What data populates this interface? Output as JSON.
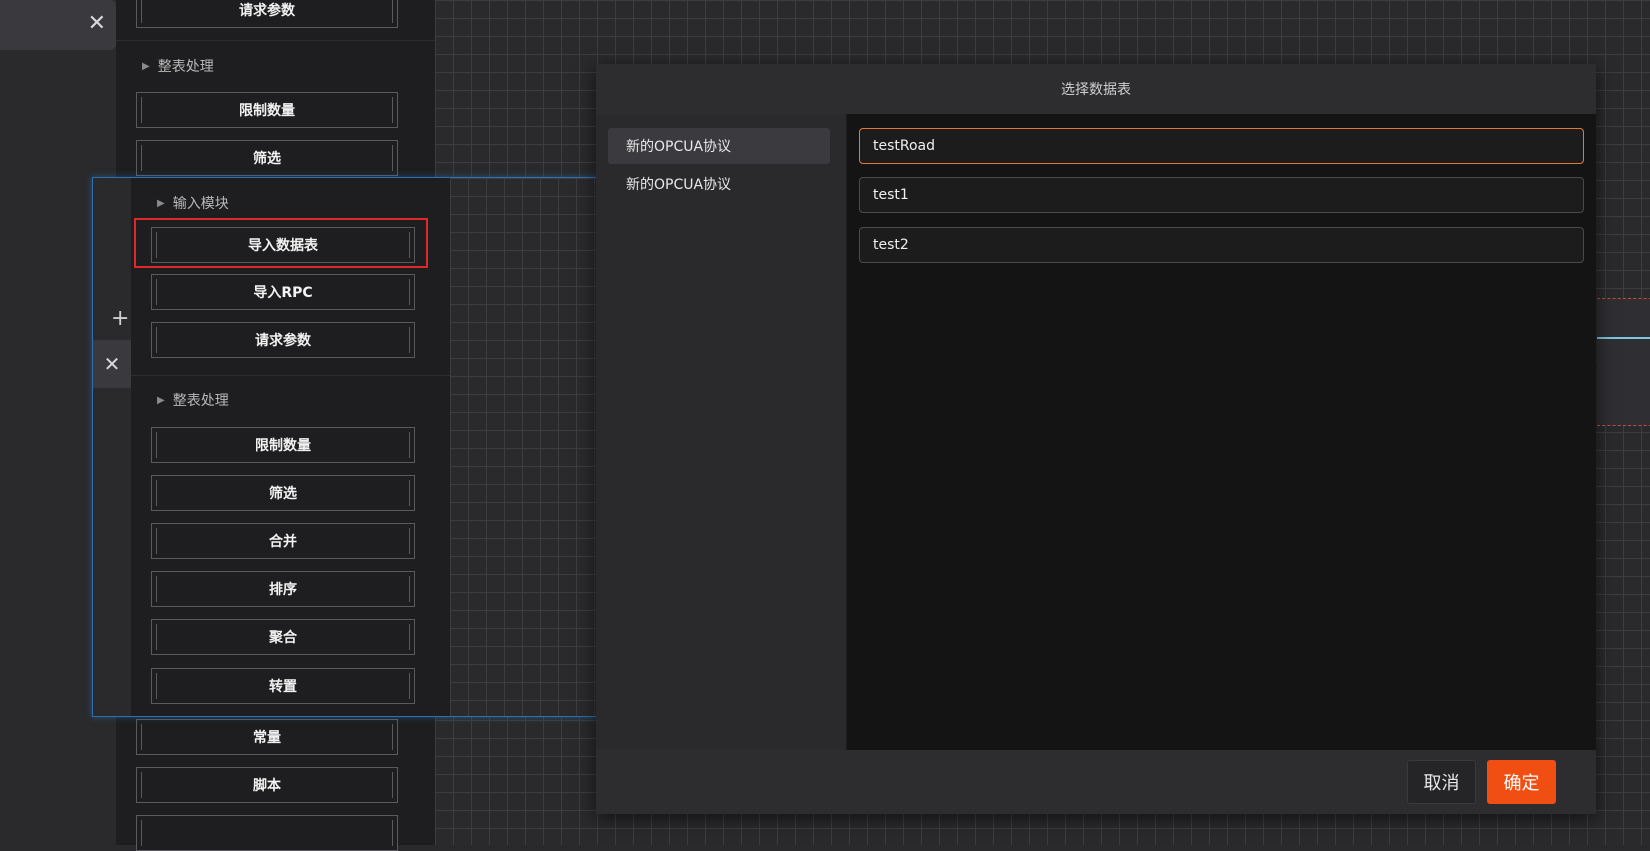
{
  "background_palette": {
    "close_icon": "close-icon",
    "top_button": "请求参数",
    "section_whole_table": "整表处理",
    "buttons_top": [
      "限制数量",
      "筛选"
    ],
    "buttons_bottom": [
      "常量",
      "脚本"
    ]
  },
  "floating_panel": {
    "plus_icon": "plus-icon",
    "close_icon": "close-icon",
    "section_input": "输入模块",
    "input_buttons": [
      "导入数据表",
      "导入RPC",
      "请求参数"
    ],
    "section_whole_table": "整表处理",
    "table_buttons": [
      "限制数量",
      "筛选",
      "合并",
      "排序",
      "聚合",
      "转置"
    ],
    "highlight_color": "#e02828"
  },
  "modal": {
    "title": "选择数据表",
    "protocols": [
      "新的OPCUA协议",
      "新的OPCUA协议"
    ],
    "tables": [
      "testRoad",
      "test1",
      "test2"
    ],
    "selected_table_color": "#e07a3a",
    "cancel_label": "取消",
    "ok_label": "确定",
    "ok_color": "#f04e12"
  }
}
